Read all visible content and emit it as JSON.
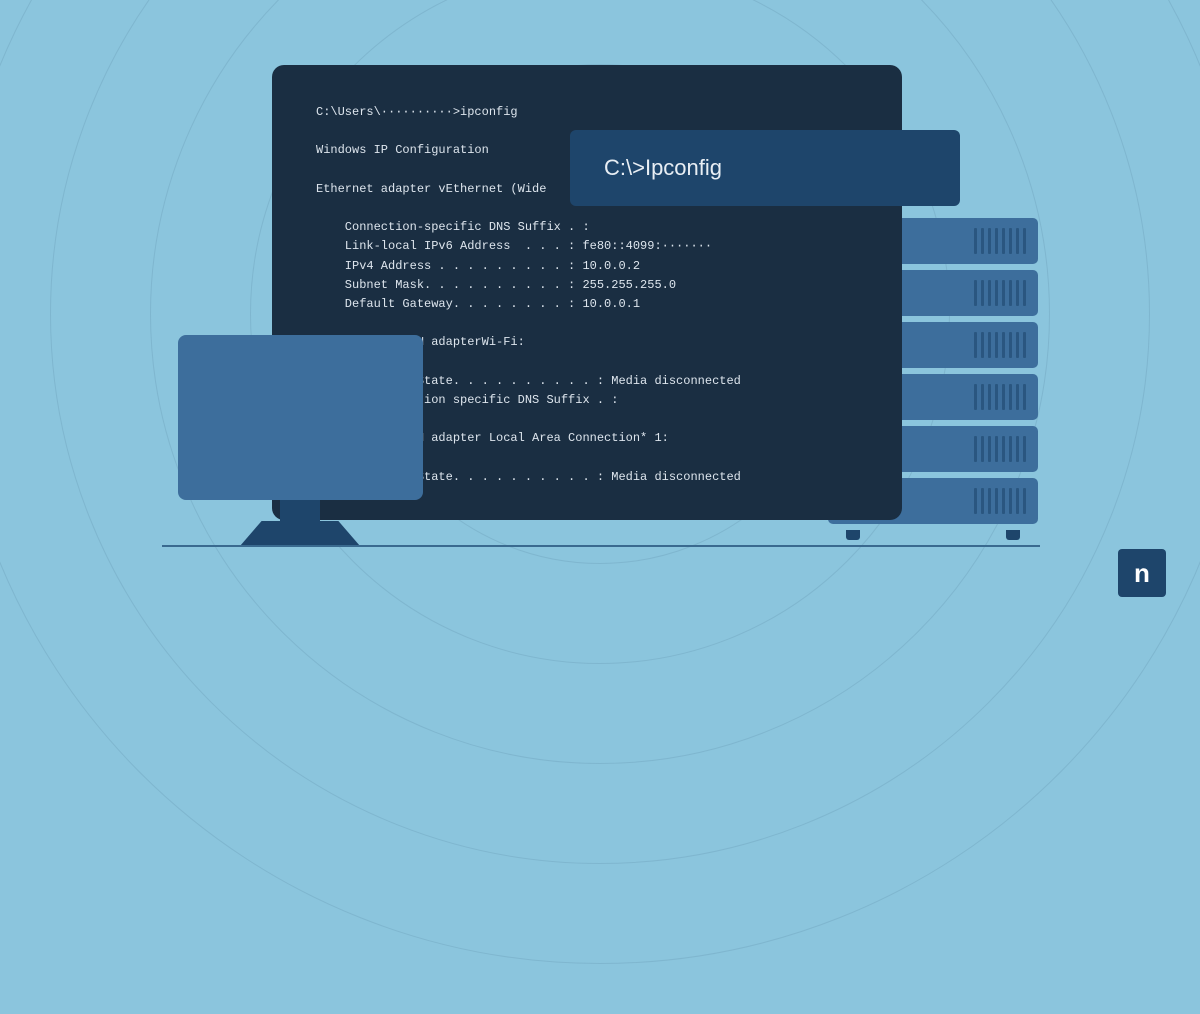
{
  "title_card": "C:\\>Ipconfig",
  "logo_letter": "n",
  "terminal_lines": [
    "C:\\Users\\··········>ipconfig",
    "",
    "Windows IP Configuration",
    "",
    "Ethernet adapter vEthernet (Wide",
    "",
    "    Connection-specific DNS Suffix . :",
    "    Link-local IPv6 Address  . . . : fe80::4099:·······",
    "    IPv4 Address . . . . . . . . . : 10.0.0.2",
    "    Subnet Mask. . . . . . . . . . : 255.255.255.0",
    "    Default Gateway. . . . . . . . : 10.0.0.1",
    "",
    "             AN adapterWi-Fi:",
    "",
    "              State. . . . . . . . . . : Media disconnected",
    "             ction specific DNS Suffix . :",
    "",
    "             AN adapter Local Area Connection* 1:",
    "",
    "              State. . . . . . . . . . : Media disconnected"
  ]
}
